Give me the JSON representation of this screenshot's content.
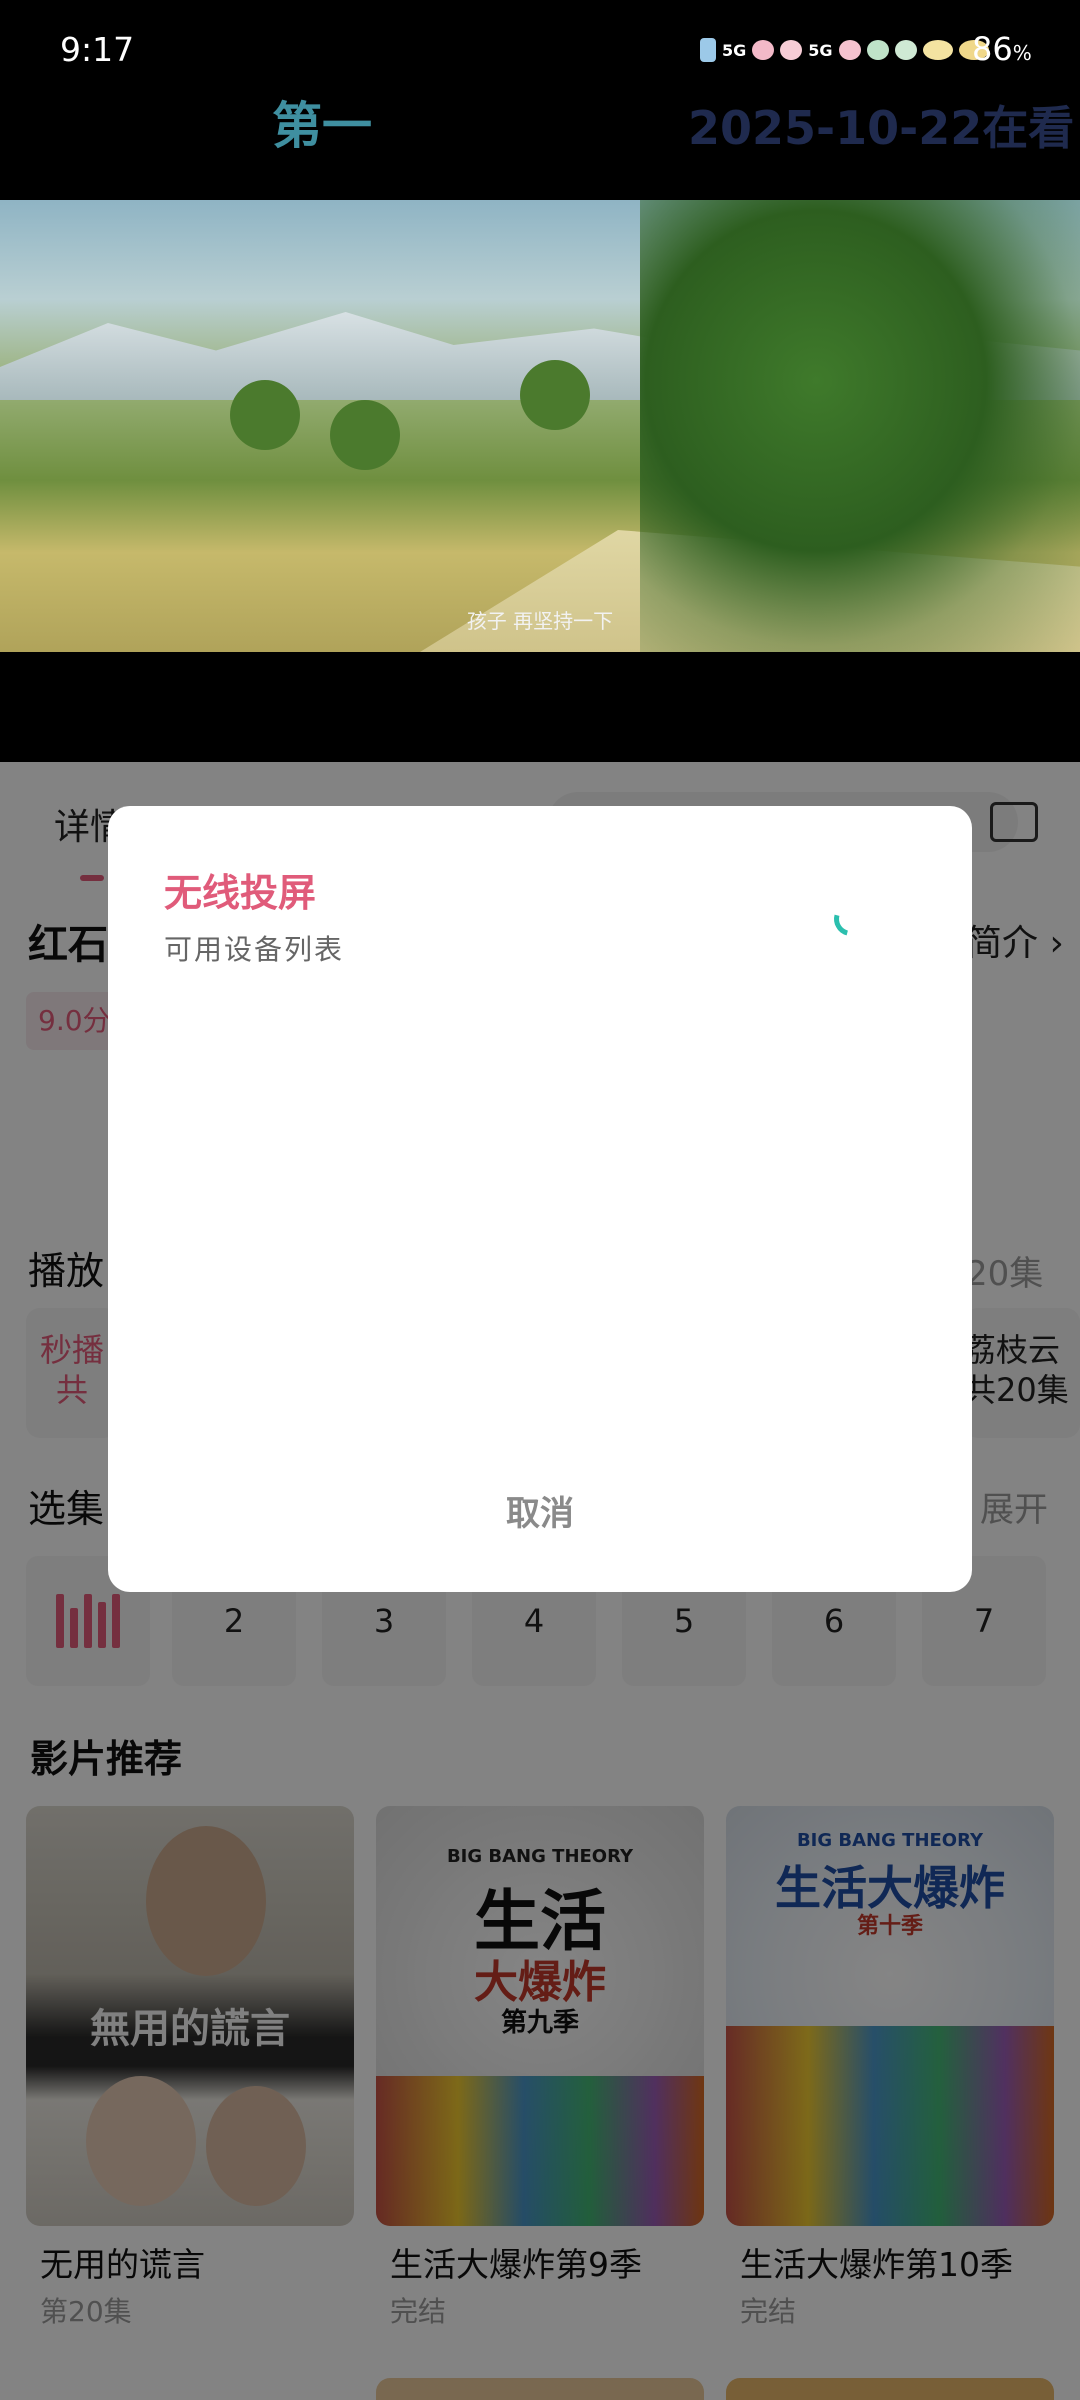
{
  "status_bar": {
    "time": "9:17",
    "signal_1": "5G",
    "signal_2": "5G",
    "battery": "86",
    "battery_unit": "%"
  },
  "video": {
    "title": "第一",
    "date_text": "2025-10-22在看",
    "subtitle": "孩子 再坚持一下"
  },
  "detail": {
    "tab_label": "详情",
    "show_title": "红石",
    "intro_link": "简介 ›",
    "score": "9.0分"
  },
  "play_sources": {
    "section_title": "播放",
    "count": "20集",
    "source_1_name": "秒播",
    "source_1_count": "共",
    "source_2_name": "荔枝云",
    "source_2_count": "共20集"
  },
  "episodes": {
    "section_title": "选集",
    "expand_label": "展开",
    "items": [
      "2",
      "3",
      "4",
      "5",
      "6",
      "7"
    ]
  },
  "recommendations": {
    "section_title": "影片推荐",
    "items": [
      {
        "name": "无用的谎言",
        "sub": "第20集",
        "poster_text": "無用的謊言"
      },
      {
        "name": "生活大爆炸第9季",
        "sub": "完结",
        "poster_brand": "BIG BANG THEORY",
        "poster_title": "生活",
        "poster_title2": "大爆炸",
        "poster_season": "第九季"
      },
      {
        "name": "生活大爆炸第10季",
        "sub": "完结",
        "poster_brand": "BIG BANG THEORY",
        "poster_title": "生活大爆炸",
        "poster_season": "第十季"
      }
    ]
  },
  "dialog": {
    "title": "无线投屏",
    "subtitle": "可用设备列表",
    "cancel_label": "取消"
  },
  "colors": {
    "accent_pink": "#e05b7a",
    "spinner_teal": "#2bbfae",
    "video_title": "#3f8fa0",
    "video_date": "#1f2a4e"
  }
}
